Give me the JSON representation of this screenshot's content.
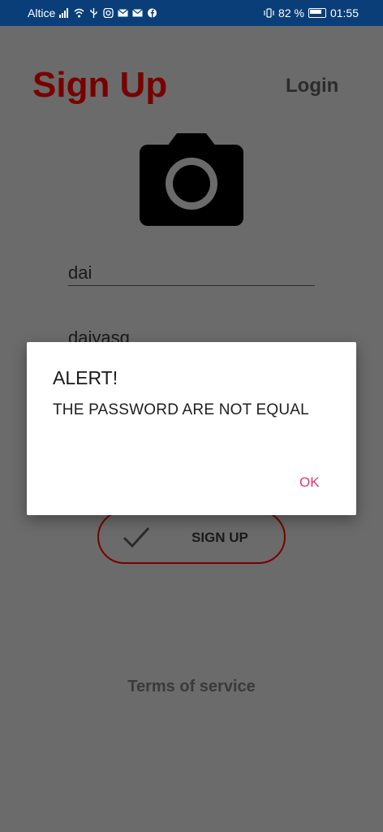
{
  "status_bar": {
    "carrier": "Altice",
    "battery_percent": "82 %",
    "time": "01:55",
    "icons": [
      "signal-icon",
      "wifi-icon",
      "usb-icon",
      "instagram-icon",
      "mail-icon",
      "mail-icon",
      "facebook-icon",
      "vibrate-icon",
      "battery-icon"
    ]
  },
  "header": {
    "title": "Sign Up",
    "login_link": "Login"
  },
  "form": {
    "camera_icon": "camera-icon",
    "field1_value": "dai",
    "field2_value": "daiyasg",
    "signup_button_label": "SIGN UP"
  },
  "footer": {
    "terms_link": "Terms of service"
  },
  "dialog": {
    "title": "ALERT!",
    "message": "THE PASSWORD ARE NOT EQUAL",
    "ok_label": "OK"
  },
  "colors": {
    "status_bar_bg": "#0a3e78",
    "title": "#7a0000",
    "accent_ok": "#e8336e",
    "overlay_bg": "#6b6b6b"
  }
}
